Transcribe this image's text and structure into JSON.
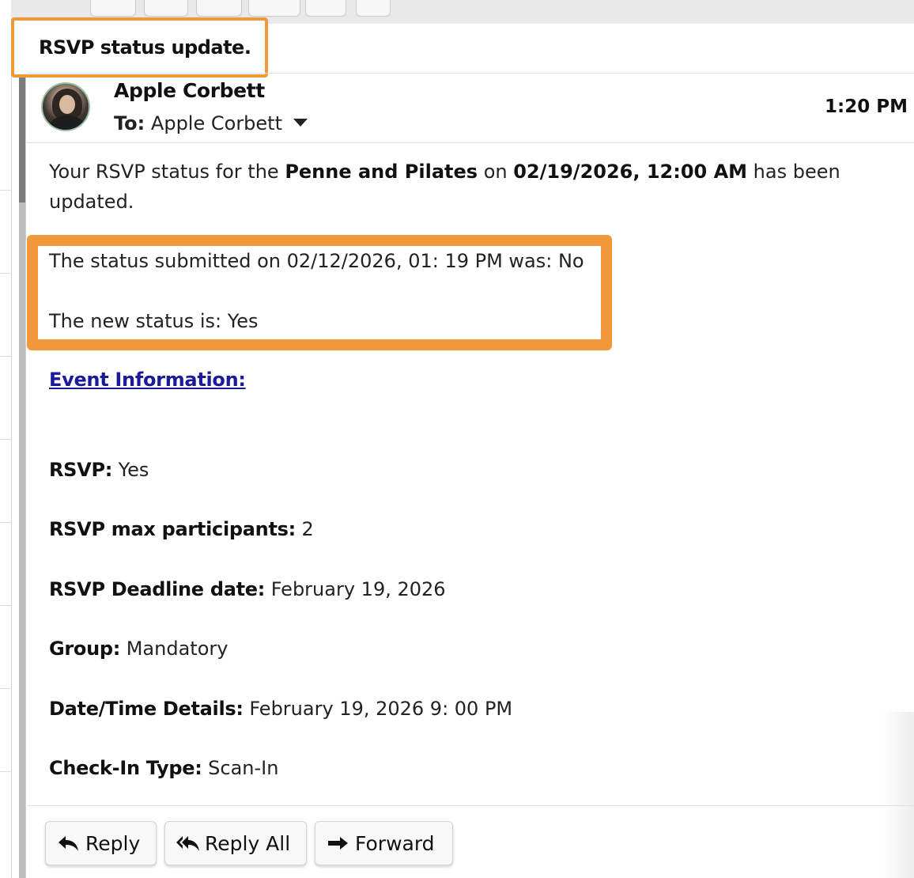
{
  "message": {
    "subject": "RSVP status update.",
    "sender": "Apple Corbett",
    "to_label": "To:",
    "to_value": "Apple Corbett",
    "time": "1:20 PM"
  },
  "body": {
    "intro_a": "Your RSVP status for the ",
    "event_name": "Penne and Pilates",
    "intro_b": " on ",
    "event_datetime": "02/19/2026, 12:00 AM",
    "intro_c": " has been",
    "intro_d": "updated.",
    "previous_status": "The status submitted on 02/12/2026, 01: 19 PM was: No",
    "new_status": "The new status is: Yes",
    "event_info_link": "Event Information:"
  },
  "details": [
    {
      "label": "RSVP:",
      "value": " Yes"
    },
    {
      "label": "RSVP max participants:",
      "value": " 2"
    },
    {
      "label": "RSVP Deadline date:",
      "value": " February 19, 2026"
    },
    {
      "label": "Group:",
      "value": " Mandatory"
    },
    {
      "label": "Date/Time Details:",
      "value": " February 19, 2026 9: 00 PM"
    },
    {
      "label": "Check-In Type:",
      "value": " Scan-In"
    }
  ],
  "actions": {
    "reply": "Reply",
    "reply_all": "Reply All",
    "forward": "Forward"
  },
  "icons": {
    "reply": "reply-arrow-icon",
    "reply_all": "reply-all-arrow-icon",
    "forward": "forward-arrow-icon",
    "recipients_toggle": "chevron-down-icon"
  },
  "colors": {
    "highlight": "#f0983a",
    "link": "#1a1a9a"
  }
}
